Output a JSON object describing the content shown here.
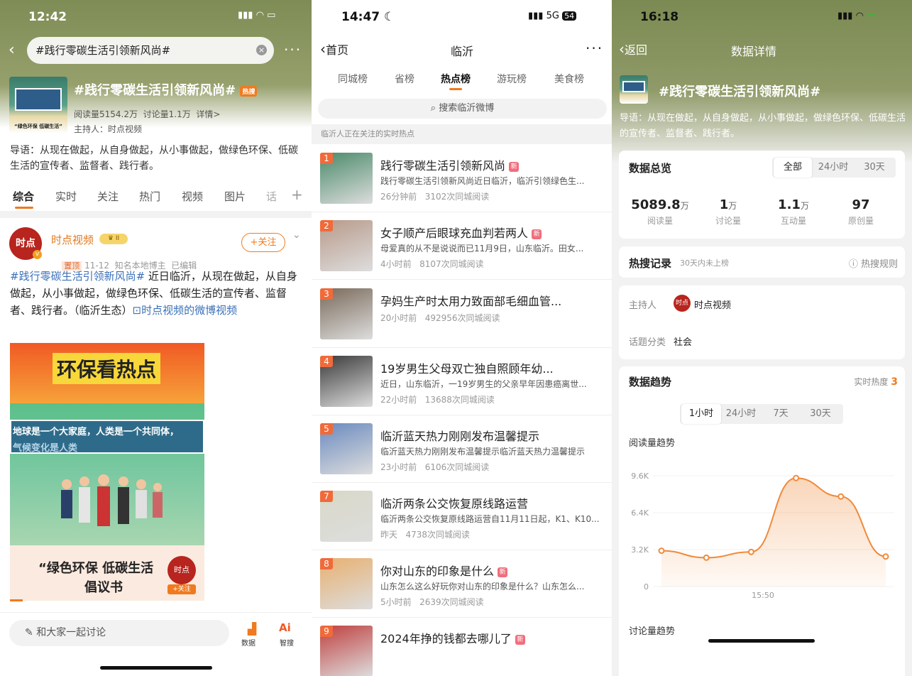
{
  "p1": {
    "status_time": "12:42",
    "search_value": "#践行零碳生活引领新风尚#",
    "topic_title": "#践行零碳生活引领新风尚#",
    "hot_badge": "热搜",
    "stats": "阅读量5154.2万  讨论量1.1万  详情>",
    "host": "主持人：时点视频",
    "intro": "导语：从现在做起，从自身做起，从小事做起，做绿色环保、低碳生活的宣传者、监督者、践行者。",
    "tabs": [
      "综合",
      "实时",
      "关注",
      "热门",
      "视频",
      "图片",
      "话"
    ],
    "thumb_caption": "“绿色环保 低碳生活”",
    "post": {
      "author": "时点视频",
      "vip": "II",
      "follow": "+关注",
      "tag": "置顶",
      "meta": "11-12  知名本地博主  已编辑",
      "hashtag": "#践行零碳生活引领新风尚#",
      "text": " 近日临沂，从现在做起，从自身做起，从小事做起，做绿色环保、低碳生活的宣传者、监督者、践行者。（临沂生态）",
      "link": "⊡时点视频的微博视频",
      "avatar_text": "时点"
    },
    "poster": {
      "headline": "环保看热点",
      "banner": "地球是一个大家庭，人类是一个共同体，",
      "banner2": "气候变化是人类",
      "bottom1": "“绿色环保 低碳生活",
      "bottom2": "倡议书",
      "follow": "+关注"
    },
    "comment_placeholder": "和大家一起讨论",
    "bottom_btns": [
      "数据",
      "智搜"
    ]
  },
  "p2": {
    "status_time": "14:47",
    "network": "5G",
    "battery": "54",
    "back": "首页",
    "title": "临沂",
    "tabs": [
      "同城榜",
      "省榜",
      "热点榜",
      "游玩榜",
      "美食榜"
    ],
    "active_tab": 2,
    "search_placeholder": "搜索临沂微博",
    "section": "临沂人正在关注的实时热点",
    "items": [
      {
        "rank": "1",
        "title": "践行零碳生活引领新风尚",
        "new": "新",
        "desc": "践行零碳生活引领新风尚近日临沂，临沂引领绿色生...",
        "meta": "26分钟前   3102次同城阅读",
        "color": "#4a8a6a"
      },
      {
        "rank": "2",
        "title": "女子顺产后眼球充血判若两人",
        "new": "新",
        "desc": "母爱真的从不是说说而已11月9日，山东临沂。田女...",
        "meta": "4小时前   8107次同城阅读",
        "color": "#b89a8a"
      },
      {
        "rank": "3",
        "title": "孕妈生产时太用力致面部毛细血管...",
        "new": "",
        "desc": "",
        "meta": "20小时前   492956次同城阅读",
        "color": "#7a6a5a"
      },
      {
        "rank": "4",
        "title": "19岁男生父母双亡独自照顾年幼...",
        "new": "",
        "desc": "近日，山东临沂，一19岁男生的父亲早年因患癌离世...",
        "meta": "22小时前   13688次同城阅读",
        "color": "#3a3a3a"
      },
      {
        "rank": "5",
        "title": "临沂蓝天热力刚刚发布温馨提示",
        "new": "",
        "desc": "临沂蓝天热力刚刚发布温馨提示临沂蓝天热力温馨提示",
        "meta": "23小时前   6106次同城阅读",
        "color": "#6a8abf"
      },
      {
        "rank": "7",
        "title": "临沂两条公交恢复原线路运营",
        "new": "",
        "desc": "临沂两条公交恢复原线路运营自11月11日起，K1、K10...",
        "meta": "昨天   4738次同城阅读",
        "color": "#d8d8c8"
      },
      {
        "rank": "8",
        "title": "你对山东的印象是什么",
        "new": "新",
        "desc": "山东怎么这么好玩你对山东的印象是什么？山东怎么...",
        "meta": "5小时前   2639次同城阅读",
        "color": "#e8b070"
      },
      {
        "rank": "9",
        "title": "2024年挣的钱都去哪儿了",
        "new": "新",
        "desc": "",
        "meta": "",
        "color": "#c04040"
      }
    ]
  },
  "p3": {
    "status_time": "16:18",
    "back": "返回",
    "title": "数据详情",
    "topic_title": "#践行零碳生活引领新风尚#",
    "intro": "导语：从现在做起，从自身做起，从小事做起，做绿色环保、低碳生活的宣传者、监督者、践行者。",
    "overview": {
      "title": "数据总览",
      "ranges": [
        "全部",
        "24小时",
        "30天"
      ],
      "stats": [
        {
          "value": "5089.8",
          "unit": "万",
          "label": "阅读量"
        },
        {
          "value": "1",
          "unit": "万",
          "label": "讨论量"
        },
        {
          "value": "1.1",
          "unit": "万",
          "label": "互动量"
        },
        {
          "value": "97",
          "unit": "",
          "label": "原创量"
        }
      ]
    },
    "hot": {
      "title": "热搜记录",
      "sub": "30天内未上榜",
      "rule": "热搜规则"
    },
    "info": {
      "host_label": "主持人",
      "host": "时点视频",
      "cat_label": "话题分类",
      "cat": "社会"
    },
    "trend": {
      "title": "数据趋势",
      "realtime_label": "实时热度",
      "realtime_value": "3",
      "ranges": [
        "1小时",
        "24小时",
        "7天",
        "30天"
      ],
      "chart_title": "阅读量趋势",
      "next_title": "讨论量趋势"
    }
  },
  "chart_data": {
    "type": "area",
    "title": "阅读量趋势",
    "x": [
      "",
      "",
      "",
      "",
      "",
      ""
    ],
    "xtick_labels": [
      "15:50"
    ],
    "values": [
      3100,
      2500,
      3000,
      9400,
      7800,
      2600
    ],
    "ylim": [
      0,
      9600
    ],
    "yticks": [
      "9.6K",
      "6.4K",
      "3.2K",
      "0"
    ],
    "color": "#f08a3a"
  }
}
